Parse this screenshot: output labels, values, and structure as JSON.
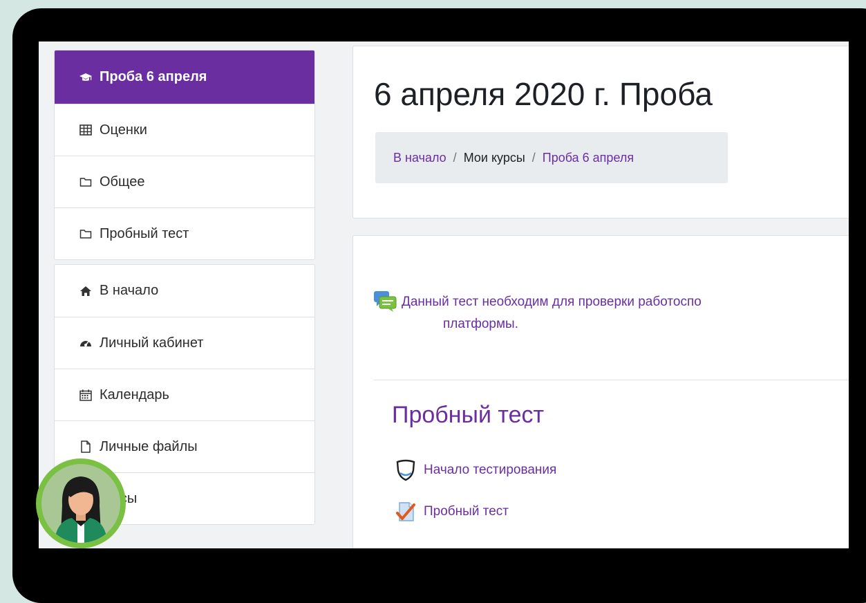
{
  "sidebar": {
    "course_items": [
      {
        "label": "Проба 6 апреля",
        "icon": "graduation-cap-icon",
        "active": true
      },
      {
        "label": "Оценки",
        "icon": "table-icon",
        "active": false
      },
      {
        "label": "Общее",
        "icon": "folder-icon",
        "active": false
      },
      {
        "label": "Пробный тест",
        "icon": "folder-icon",
        "active": false
      }
    ],
    "site_items": [
      {
        "label": "В начало",
        "icon": "home-icon"
      },
      {
        "label": "Личный кабинет",
        "icon": "dashboard-icon"
      },
      {
        "label": "Календарь",
        "icon": "calendar-icon"
      },
      {
        "label": "Личные файлы",
        "icon": "file-icon"
      },
      {
        "label": "курсы",
        "icon": "courses-icon"
      }
    ]
  },
  "header": {
    "title": "6 апреля 2020 г. Проба",
    "breadcrumb": {
      "home": "В начало",
      "separator": "/",
      "my_courses": "Мои курсы",
      "current": "Проба 6 апреля"
    }
  },
  "content": {
    "forum_text_line1": "Данный тест необходим для проверки работоспо",
    "forum_text_line2": "платформы.",
    "section_title": "Пробный тест",
    "activities": [
      {
        "label": "Начало тестирования",
        "icon": "shield-icon"
      },
      {
        "label": "Пробный тест",
        "icon": "quiz-icon"
      }
    ]
  },
  "colors": {
    "accent": "#6a2ea0",
    "frame": "#000000",
    "background": "#d5e7e2",
    "avatar_ring": "#7ac143"
  }
}
